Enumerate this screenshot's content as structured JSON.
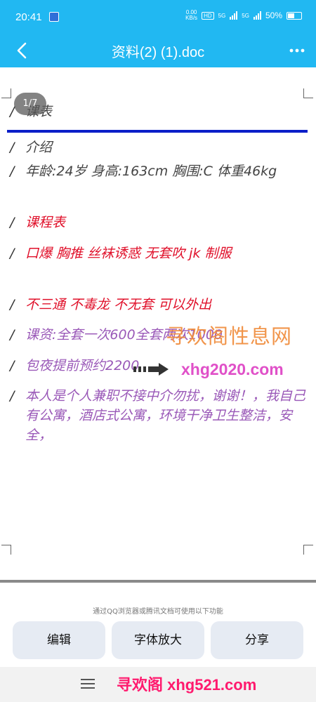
{
  "status": {
    "time": "20:41",
    "speed_value": "0.00",
    "speed_unit": "KB/s",
    "hd": "HD",
    "net1": "5G",
    "net2": "5G",
    "battery": "50%"
  },
  "titlebar": {
    "title": "资料(2) (1).doc"
  },
  "document": {
    "page_indicator": "1/7",
    "paragraphs": [
      {
        "mark": "/",
        "text": "课表",
        "color": "#444444"
      },
      {
        "mark": "/",
        "text": "介绍",
        "color": "#444444"
      },
      {
        "mark": "/",
        "text": "年龄:24岁  身高:163cm  胸围:C  体重46kg",
        "color": "#444444"
      },
      {
        "mark": "/",
        "text": "课程表",
        "color": "#e0102a"
      },
      {
        "mark": "/",
        "text": "口爆    胸推    丝袜诱惑    无套吹    jk    制服",
        "color": "#e0102a"
      },
      {
        "mark": "/",
        "text": "不三通  不毒龙  不无套    可以外出",
        "color": "#e0102a"
      },
      {
        "mark": "/",
        "text": "课资:全套一次600全套两次1000",
        "color": "#9a59b8"
      },
      {
        "mark": "/",
        "text": "包夜提前预约2200",
        "color": "#9a59b8"
      },
      {
        "mark": "/",
        "text": "本人是个人兼职不接中介勿扰，谢谢！，我自己有公寓，酒店式公寓，环境干净卫生整洁，安全，",
        "color": "#9a59b8"
      }
    ]
  },
  "watermarks": {
    "site_name": "寻欢阁性息网",
    "site_url": "xhg2020.com",
    "bottom_text": "寻欢阁 xhg521.com"
  },
  "footer": {
    "hint": "通过QQ浏览器或腾讯文档可使用以下功能",
    "buttons": [
      "编辑",
      "字体放大",
      "分享"
    ]
  },
  "icons": {
    "back": "chevron-left-icon",
    "more": "more-dots-icon",
    "menu": "hamburger-menu-icon"
  }
}
